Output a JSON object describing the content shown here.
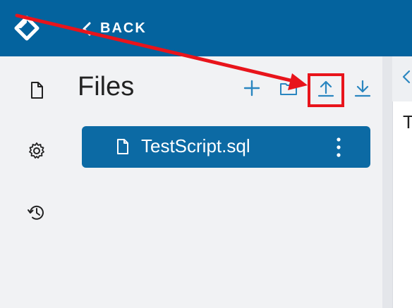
{
  "header": {
    "back_label": "BACK"
  },
  "rail": {
    "items": [
      {
        "icon": "file-icon"
      },
      {
        "icon": "gear-icon"
      },
      {
        "icon": "history-icon"
      }
    ]
  },
  "files": {
    "title": "Files",
    "toolbar": [
      {
        "icon": "plus-icon"
      },
      {
        "icon": "new-folder-icon"
      },
      {
        "icon": "upload-icon",
        "highlighted": true
      },
      {
        "icon": "download-icon"
      }
    ],
    "list": [
      {
        "name": "TestScript.sql",
        "selected": true
      }
    ]
  },
  "editor": {
    "visible_text": "T"
  },
  "colors": {
    "header_bg": "#04639e",
    "accent": "#0c6aa4",
    "icon_blue": "#2a86c0",
    "annotation_red": "#e8141b",
    "panel_bg": "#f1f2f4"
  }
}
